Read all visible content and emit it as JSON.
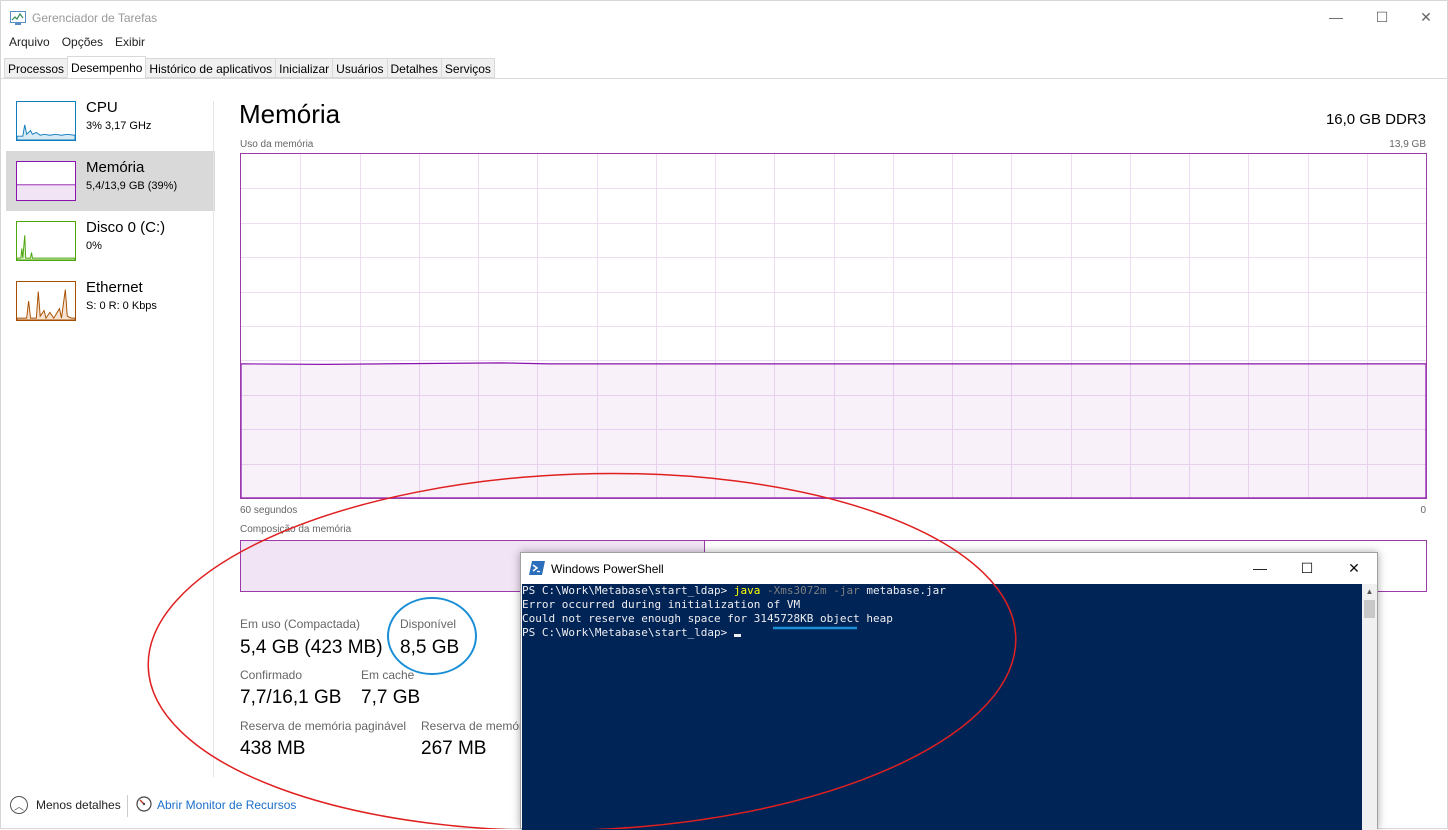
{
  "window": {
    "title": "Gerenciador de Tarefas",
    "minimize_glyph": "—",
    "maximize_glyph": "☐",
    "close_glyph": "✕"
  },
  "menu": [
    "Arquivo",
    "Opções",
    "Exibir"
  ],
  "tabs": [
    "Processos",
    "Desempenho",
    "Histórico de aplicativos",
    "Inicializar",
    "Usuários",
    "Detalhes",
    "Serviços"
  ],
  "active_tab": "Desempenho",
  "sidebar": {
    "items": [
      {
        "name": "CPU",
        "sub": "3% 3,17 GHz",
        "color": "#117dbb"
      },
      {
        "name": "Memória",
        "sub": "5,4/13,9 GB (39%)",
        "color": "#8b12ae"
      },
      {
        "name": "Disco 0 (C:)",
        "sub": "0%",
        "color": "#4da60c"
      },
      {
        "name": "Ethernet",
        "sub": "S: 0 R: 0 Kbps",
        "color": "#a74f01"
      }
    ]
  },
  "main": {
    "title": "Memória",
    "spec": "16,0 GB DDR3",
    "graph_label": "Uso da memória",
    "graph_max": "13,9 GB",
    "time_left": "60 segundos",
    "time_right": "0",
    "usage_fraction": 0.39,
    "composition_label": "Composição da memória",
    "stats": {
      "in_use_label": "Em uso (Compactada)",
      "in_use_value": "5,4 GB (423 MB)",
      "available_label": "Disponível",
      "available_value": "8,5 GB",
      "committed_label": "Confirmado",
      "committed_value": "7,7/16,1 GB",
      "cached_label": "Em cache",
      "cached_value": "7,7 GB",
      "paged_label": "Reserva de memória paginável",
      "paged_value": "438 MB",
      "nonpaged_label": "Reserva de memóri",
      "nonpaged_value": "267 MB"
    }
  },
  "footer": {
    "less_details": "Menos detalhes",
    "resource_monitor": "Abrir Monitor de Recursos"
  },
  "powershell": {
    "title": "Windows PowerShell",
    "prompt": "PS C:\\Work\\Metabase\\start_ldap> ",
    "cmd_java": "java",
    "cmd_args": " -Xms3072m -jar",
    "cmd_jar": " metabase.jar",
    "line2": "Error occurred during initialization of VM",
    "line3": "Could not reserve enough space for 3145728KB object heap",
    "prompt2": "PS C:\\Work\\Metabase\\start_ldap> "
  },
  "colors": {
    "memory_accent": "#8b12ae",
    "annotation_red": "#e02020",
    "annotation_blue": "#1a8fd6",
    "console_bg": "#012456"
  }
}
